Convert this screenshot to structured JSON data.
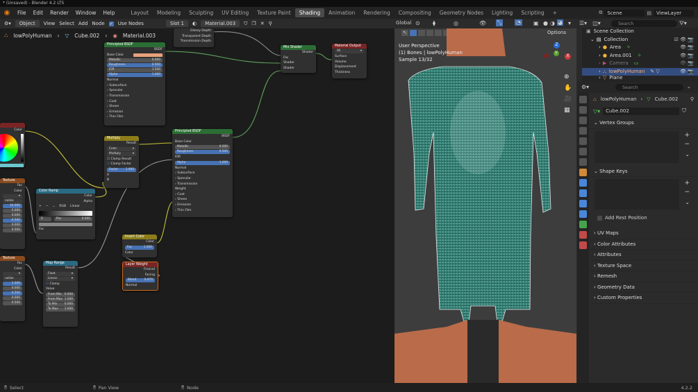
{
  "window_title": "* (Unsaved) - Blender 4.2 LTS",
  "menu": [
    "File",
    "Edit",
    "Render",
    "Window",
    "Help"
  ],
  "workspaces": [
    "Layout",
    "Modeling",
    "Sculpting",
    "UV Editing",
    "Texture Paint",
    "Shading",
    "Animation",
    "Rendering",
    "Compositing",
    "Geometry Nodes",
    "Lighting",
    "Scripting"
  ],
  "active_workspace": "Shading",
  "scene_name": "Scene",
  "viewlayer_name": "ViewLayer",
  "node_header": {
    "object_mode": "Object",
    "menus": [
      "View",
      "Select",
      "Add",
      "Node"
    ],
    "use_nodes_label": "Use Nodes",
    "slot": "Slot 1",
    "material": "Material.003",
    "options": "Options"
  },
  "breadcrumb": [
    "lowPolyHuman",
    "Cube.002",
    "Material.003"
  ],
  "nodes": {
    "pb1": {
      "title": "Principled BSDF",
      "out": "BSDF",
      "base_color": "Base Color",
      "metallic": [
        "Metallic",
        "0.000"
      ],
      "roughness": [
        "Roughness",
        "0.500"
      ],
      "ior": [
        "IOR",
        "1.500"
      ],
      "alpha": [
        "Alpha",
        "1.000"
      ],
      "normal": "Normal",
      "subs": [
        "Subsurface",
        "Specular",
        "Transmission",
        "Coat",
        "Sheen",
        "Emission",
        "Thin Film"
      ]
    },
    "pb2": {
      "title": "Principled BSDF",
      "out": "BSDF",
      "base_color": "Base Color",
      "metallic": [
        "Metallic",
        "0.000"
      ],
      "roughness": [
        "Roughness",
        "0.500"
      ],
      "ior": "IOR",
      "alpha": [
        "Alpha",
        "1.000"
      ],
      "normal": "Normal",
      "subs1": [
        "Subsurface",
        "Specular",
        "Transmission"
      ],
      "weight": "Weight",
      "subs2": [
        "Coat",
        "Sheen",
        "Emission",
        "Thin Film"
      ]
    },
    "light_path": {
      "outs": [
        "Glossy Depth",
        "Transparent Depth",
        "Transmission Depth"
      ]
    },
    "mix_shader": {
      "title": "Mix Shader",
      "out": "Shader",
      "ins": [
        "Fac",
        "Shader",
        "Shader"
      ]
    },
    "mat_output": {
      "title": "Material Output",
      "target": "All",
      "ins": [
        "Surface",
        "Volume",
        "Displacement",
        "Thickness"
      ]
    },
    "multiply": {
      "title": "Multiply",
      "out": "Result",
      "type": "Color",
      "mode": "Multiply",
      "clamp_result": "Clamp Result",
      "clamp_factor": "Clamp Factor",
      "factor": [
        "Factor",
        "1.000"
      ],
      "a": "A",
      "b": "B"
    },
    "color_ramp": {
      "title": "Color Ramp",
      "outs": [
        "Color",
        "Alpha"
      ],
      "mode": "RGB",
      "interp": "Linear",
      "pos_index": "0",
      "pos_label": "Pos",
      "pos_value": "0.000",
      "fac": "Fac"
    },
    "map_range": {
      "title": "Map Range",
      "out": "Result",
      "type": "Float",
      "interp": "Linear",
      "clamp": "Clamp",
      "value": "Value",
      "from_min": [
        "From Min",
        "0.000"
      ],
      "from_max": [
        "From Max",
        "1.000"
      ],
      "to_min": [
        "To Min",
        "0.000"
      ],
      "to_max": [
        "To Max",
        "1.000"
      ]
    },
    "invert_color": {
      "title": "Invert Color",
      "out": "Color",
      "fac": [
        "Fac",
        "1.000"
      ],
      "color": "Color"
    },
    "layer_weight": {
      "title": "Layer Weight",
      "outs": [
        "Fresnel",
        "Facing"
      ],
      "blend": [
        "Blend",
        "0.970"
      ],
      "normal": "Normal"
    },
    "tex_left1": {
      "title": "Texture",
      "outs": [
        "Fac",
        "Color"
      ],
      "values": [
        "10.000",
        "5.000",
        "0.000",
        "0.500",
        "0.000",
        "0.500"
      ]
    },
    "tex_left2": {
      "title": "Texture",
      "outs": [
        "Fac",
        "Color"
      ],
      "values": [
        "1.000",
        "0.000",
        "0.500",
        "0.000",
        "0.500"
      ]
    },
    "color_node_left": {
      "out": "Color"
    }
  },
  "viewport": {
    "header_label": "Global",
    "overlay_title": "User Perspective",
    "overlay_object": "(1) Bones | lowPolyHuman",
    "overlay_sample": "Sample 13/32",
    "gizmo_axes": [
      "X",
      "Y",
      "Z"
    ]
  },
  "outliner": {
    "search_placeholder": "Search",
    "rows": [
      {
        "label": "Scene Collection",
        "type": "scene"
      },
      {
        "label": "Collection",
        "type": "collection"
      },
      {
        "label": "Area",
        "type": "light"
      },
      {
        "label": "Area.001",
        "type": "light"
      },
      {
        "label": "Camera",
        "type": "camera"
      },
      {
        "label": "lowPolyHuman",
        "type": "armature",
        "selected": true
      },
      {
        "label": "Plane",
        "type": "mesh"
      }
    ]
  },
  "properties": {
    "search_placeholder": "Search",
    "breadcrumb": [
      "lowPolyHuman",
      "Cube.002"
    ],
    "mesh_name": "Cube.002",
    "sections": [
      "Vertex Groups",
      "Shape Keys"
    ],
    "add_rest_position": "Add Rest Position",
    "collapsed": [
      "UV Maps",
      "Color Attributes",
      "Attributes",
      "Texture Space",
      "Remesh",
      "Geometry Data",
      "Custom Properties"
    ]
  },
  "status_bar": {
    "select": "Select",
    "pan": "Pan View",
    "node": "Node",
    "version": "4.2.2"
  },
  "colors": {
    "accent": "#4772b3",
    "green_node": "#2b6e35",
    "yellow_node": "#8c7d1a",
    "cyan_node": "#2a6a82",
    "red_node": "#7a2525",
    "mesh_teal": "#3c8c80",
    "skin": "#b96b4a"
  }
}
